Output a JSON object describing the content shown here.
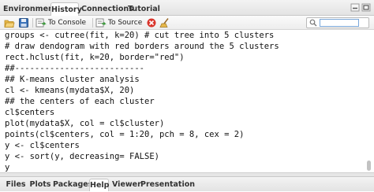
{
  "top_tabs": [
    "Environment",
    "History",
    "Connections",
    "Tutorial"
  ],
  "active_top_tab": "History",
  "toolbar": {
    "to_console_label": "To Console",
    "to_source_label": "To Source",
    "search_value": ""
  },
  "history_lines": [
    "groups <- cutree(fit, k=20) # cut tree into 5 clusters",
    "# draw dendogram with red borders around the 5 clusters",
    "rect.hclust(fit, k=20, border=\"red\")",
    "##--------------------------",
    "## K-means cluster analysis",
    "cl <- kmeans(mydata$X, 20)",
    "## the centers of each cluster",
    "cl$centers",
    "plot(mydata$X, col = cl$cluster)",
    "points(cl$centers, col = 1:20, pch = 8, cex = 2)",
    "y <- cl$centers",
    "y <- sort(y, decreasing= FALSE)",
    "y"
  ],
  "bottom_tabs": [
    "Files",
    "Plots",
    "Packages",
    "Help",
    "Viewer",
    "Presentation"
  ],
  "active_bottom_tab": "Help",
  "colors": {
    "accent_green": "#3a9a3a",
    "delete_red": "#d9342b",
    "save_blue": "#3b73b9"
  }
}
